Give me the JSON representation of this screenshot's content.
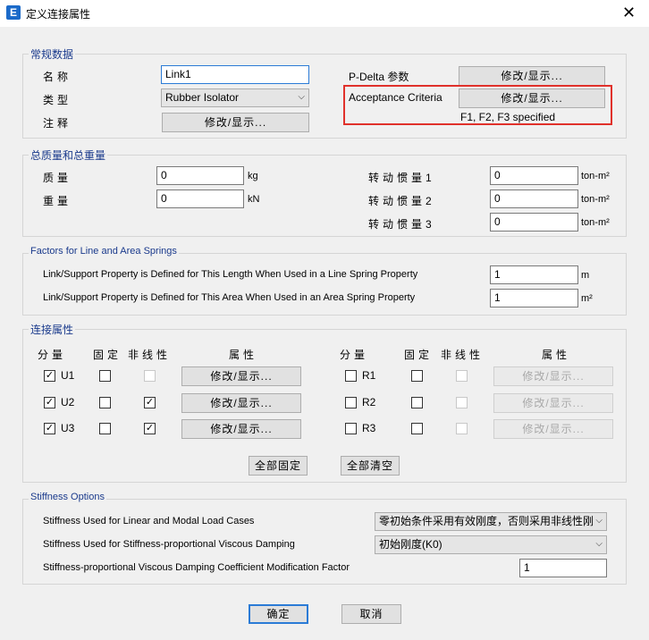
{
  "window": {
    "title": "定义连接属性",
    "app_icon": "E",
    "close": "✕"
  },
  "general": {
    "title": "常规数据",
    "name_label": "名称",
    "name_value": "Link1",
    "type_label": "类型",
    "type_value": "Rubber Isolator",
    "notes_label": "注释",
    "modify_show": "修改/显示...",
    "pdelta_label": "P-Delta 参数",
    "acceptance_label": "Acceptance Criteria",
    "acceptance_status": "F1, F2, F3 specified"
  },
  "mass": {
    "title": "总质量和总重量",
    "mass_label": "质量",
    "mass_value": "0",
    "mass_unit": "kg",
    "weight_label": "重量",
    "weight_value": "0",
    "weight_unit": "kN",
    "inertia1_label": "转动惯量1",
    "inertia1_value": "0",
    "inertia2_label": "转动惯量2",
    "inertia2_value": "0",
    "inertia3_label": "转动惯量3",
    "inertia3_value": "0",
    "inertia_unit": "ton-m²"
  },
  "springs": {
    "title": "Factors for Line and Area Springs",
    "line_label": "Link/Support Property is Defined for This Length When Used in a Line Spring Property",
    "line_value": "1",
    "line_unit": "m",
    "area_label": "Link/Support Property is Defined for This Area When Used in an Area Spring Property",
    "area_value": "1",
    "area_unit": "m²"
  },
  "dof": {
    "title": "连接属性",
    "headers": {
      "component": "分量",
      "fixed": "固定",
      "nonlinear": "非线性",
      "property": "属性"
    },
    "rows_left": [
      {
        "name": "U1",
        "checked": true,
        "fixed": false,
        "nonlinear": false,
        "nonlinear_disabled": true
      },
      {
        "name": "U2",
        "checked": true,
        "fixed": false,
        "nonlinear": true,
        "nonlinear_disabled": false
      },
      {
        "name": "U3",
        "checked": true,
        "fixed": false,
        "nonlinear": true,
        "nonlinear_disabled": false
      }
    ],
    "rows_right": [
      {
        "name": "R1",
        "checked": false,
        "fixed": false,
        "nonlinear": false
      },
      {
        "name": "R2",
        "checked": false,
        "fixed": false,
        "nonlinear": false
      },
      {
        "name": "R3",
        "checked": false,
        "fixed": false,
        "nonlinear": false
      }
    ],
    "modify_show": "修改/显示...",
    "fix_all": "全部固定",
    "clear_all": "全部清空"
  },
  "stiffness": {
    "title": "Stiffness Options",
    "linear_label": "Stiffness Used for Linear and Modal Load Cases",
    "linear_value": "零初始条件采用有效刚度，否则采用非线性刚",
    "viscous_label": "Stiffness Used for Stiffness-proportional Viscous Damping",
    "viscous_value": "初始刚度(K0)",
    "factor_label": "Stiffness-proportional Viscous Damping Coefficient Modification Factor",
    "factor_value": "1"
  },
  "buttons": {
    "ok": "确定",
    "cancel": "取消"
  },
  "colors": {
    "group_title": "#1a3a8c",
    "highlight_box": "#e0312b",
    "focus_border": "#2b7bd6"
  }
}
